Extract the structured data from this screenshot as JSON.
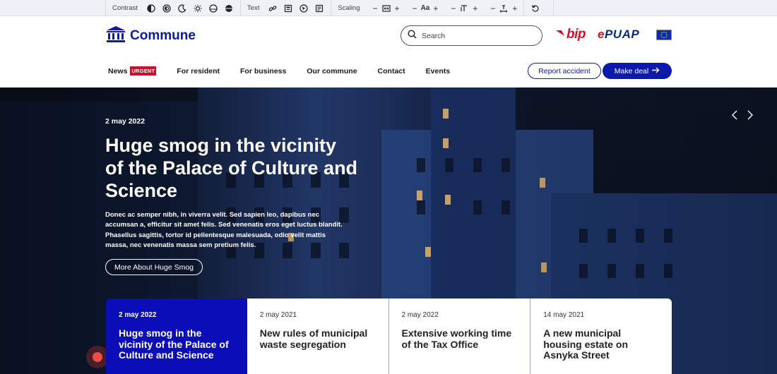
{
  "a11y": {
    "contrast_label": "Contrast",
    "text_label": "Text",
    "scaling_label": "Scaling",
    "font_size_symbol": "Aa",
    "contrast_icons": [
      "contrast-half-icon",
      "contrast-ring-icon",
      "moon-icon",
      "sun-icon",
      "circle-outline-icon",
      "circle-filled-icon"
    ],
    "text_icons": [
      "link-icon",
      "table-icon",
      "cursor-icon",
      "text-doc-icon"
    ],
    "scaling_icons": [
      "width-icon",
      "font-size-icon",
      "line-height-icon",
      "spacing-icon",
      "reset-icon"
    ]
  },
  "header": {
    "logo_text": "Commune",
    "search_placeholder": "Search",
    "bip_text": "bip",
    "epuap_e": "e",
    "epuap_rest": "PUAP"
  },
  "nav": {
    "items": [
      {
        "label": "News",
        "badge": "URGENT"
      },
      {
        "label": "For resident"
      },
      {
        "label": "For business"
      },
      {
        "label": "Our commune"
      },
      {
        "label": "Contact"
      },
      {
        "label": "Events"
      }
    ],
    "report_button": "Report accident",
    "deal_button": "Make deal"
  },
  "hero": {
    "date": "2 may 2022",
    "title": "Huge smog in the vicinity of the Palace of Culture and Science",
    "description": "Donec ac semper nibh, in viverra velit. Sed sapien leo, dapibus nec accumsan a, efficitur sit amet felis. Sed venenatis eros eget luctus blandit. Phasellus sagittis, tortor id pellentesque malesuada, odio velit mattis massa, nec venenatis massa sem pretium felis.",
    "button": "More About Huge Smog"
  },
  "news_cards": [
    {
      "date": "2 may 2022",
      "title": "Huge smog in the vicinity of the Palace of Culture and Science",
      "active": true
    },
    {
      "date": "2 may 2021",
      "title": "New rules of municipal waste segregation"
    },
    {
      "date": "2 may 2022",
      "title": "Extensive working time of the Tax Office"
    },
    {
      "date": "14 may 2021",
      "title": "A new municipal housing estate on Asnyka Street"
    }
  ],
  "colors": {
    "brand_blue": "#0b1aa8",
    "active_card": "#0b0db8",
    "urgent_red": "#c8102e",
    "hero_bg": "#132244"
  }
}
